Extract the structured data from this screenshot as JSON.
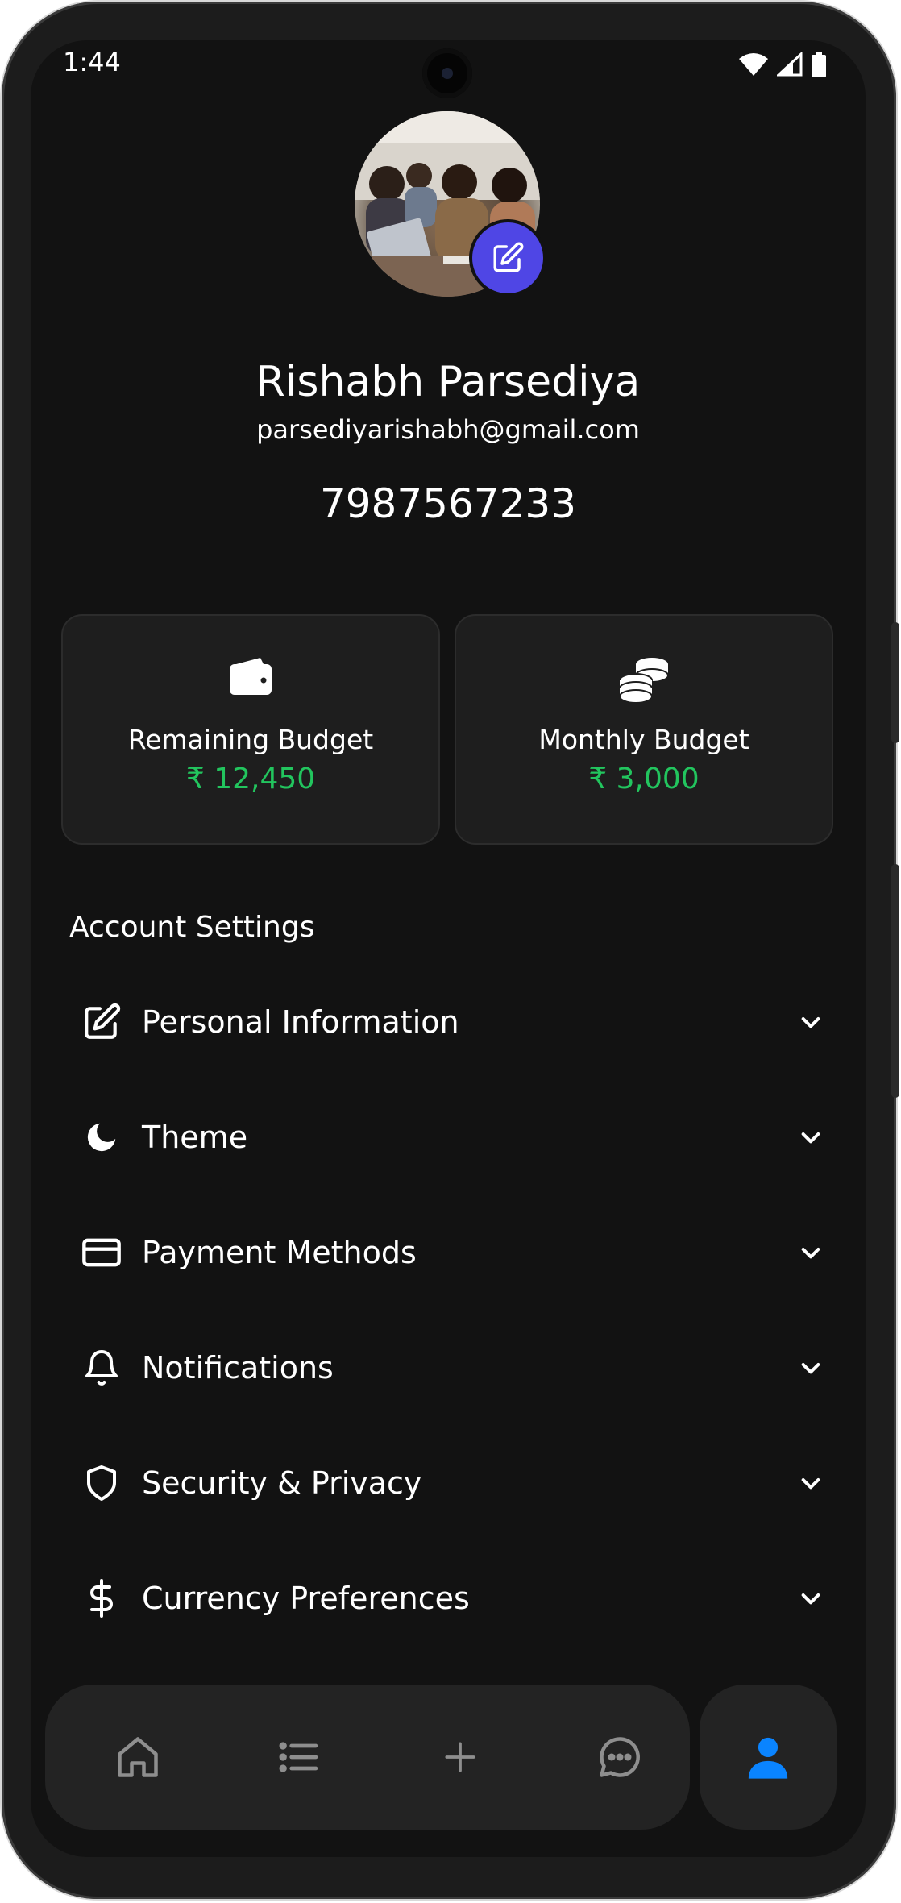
{
  "status_bar": {
    "time": "1:44"
  },
  "profile": {
    "name": "Rishabh Parsediya",
    "email": "parsediyarishabh@gmail.com",
    "phone": "7987567233"
  },
  "budget_cards": [
    {
      "icon": "wallet-icon",
      "label": "Remaining Budget",
      "value": "₹ 12,450"
    },
    {
      "icon": "coins-icon",
      "label": "Monthly Budget",
      "value": "₹ 3,000"
    }
  ],
  "account_settings": {
    "title": "Account Settings",
    "items": [
      {
        "icon": "edit-icon",
        "label": "Personal Information"
      },
      {
        "icon": "moon-icon",
        "label": "Theme"
      },
      {
        "icon": "credit-card-icon",
        "label": "Payment Methods"
      },
      {
        "icon": "bell-icon",
        "label": "Notifications"
      },
      {
        "icon": "shield-icon",
        "label": "Security & Privacy"
      },
      {
        "icon": "dollar-icon",
        "label": "Currency Preferences"
      }
    ]
  },
  "bottom_nav": {
    "items": [
      "home-icon",
      "list-icon",
      "plus-icon",
      "chat-icon",
      "user-icon"
    ],
    "active": "user-icon"
  },
  "colors": {
    "background": "#121212",
    "card": "#1e1e1e",
    "accent_green": "#22c55e",
    "edit_button": "#4f46e5",
    "active_tab": "#0a84ff"
  }
}
